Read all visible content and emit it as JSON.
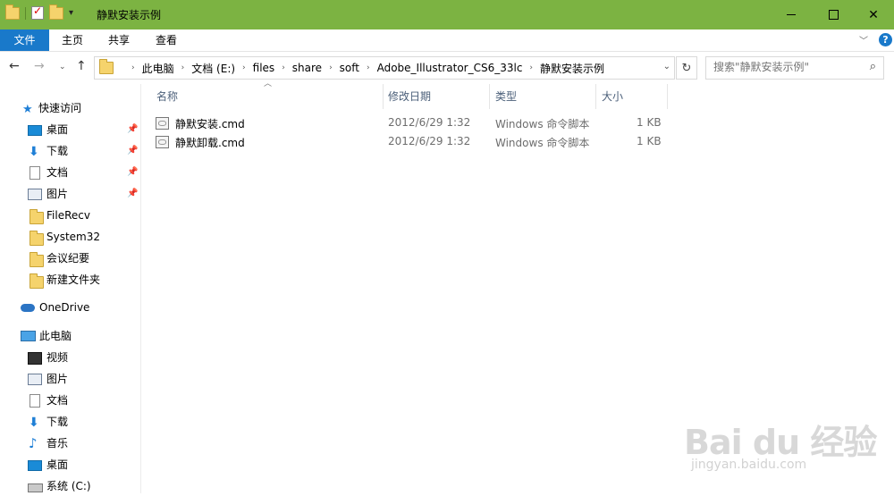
{
  "window": {
    "title": "静默安装示例"
  },
  "ribbon": {
    "tabs": {
      "file": "文件",
      "home": "主页",
      "share": "共享",
      "view": "查看"
    },
    "help": "?"
  },
  "address": {
    "crumbs": [
      "此电脑",
      "文档 (E:)",
      "files",
      "share",
      "soft",
      "Adobe_Illustrator_CS6_33lc",
      "静默安装示例"
    ]
  },
  "search": {
    "placeholder": "搜索\"静默安装示例\""
  },
  "nav": {
    "quick_access": "快速访问",
    "quick_items": [
      "桌面",
      "下载",
      "文档",
      "图片",
      "FileRecv",
      "System32",
      "会议纪要",
      "新建文件夹"
    ],
    "onedrive": "OneDrive",
    "this_pc": "此电脑",
    "pc_items": [
      "视频",
      "图片",
      "文档",
      "下载",
      "音乐",
      "桌面",
      "系统 (C:)"
    ]
  },
  "columns": {
    "name": "名称",
    "modified": "修改日期",
    "type": "类型",
    "size": "大小"
  },
  "files": [
    {
      "name": "静默安装.cmd",
      "modified": "2012/6/29 1:32",
      "type": "Windows 命令脚本",
      "size": "1 KB"
    },
    {
      "name": "静默卸载.cmd",
      "modified": "2012/6/29 1:32",
      "type": "Windows 命令脚本",
      "size": "1 KB"
    }
  ],
  "watermark": {
    "brand": "Bai du 经验",
    "url": "jingyan.baidu.com"
  },
  "colors": {
    "titlebar": "#7cb342",
    "accent": "#1979ca"
  }
}
